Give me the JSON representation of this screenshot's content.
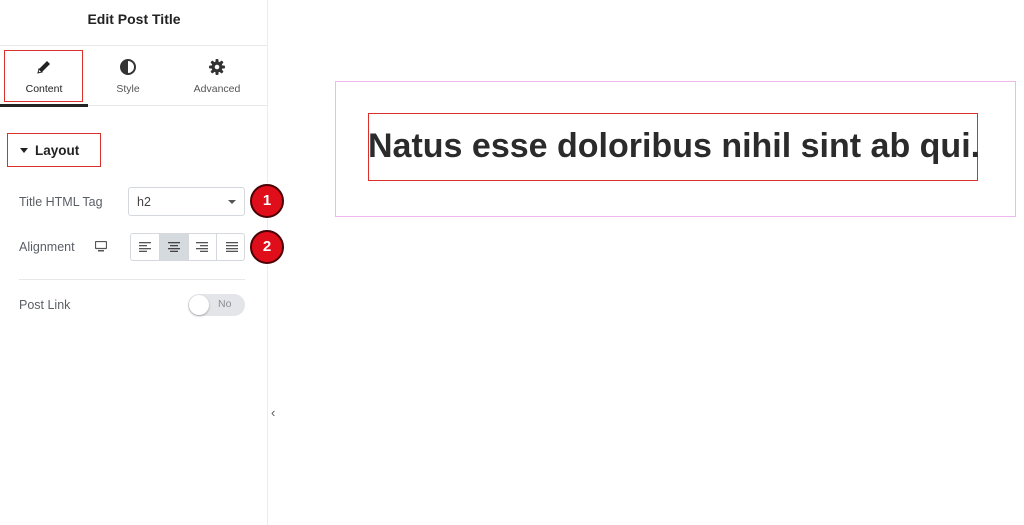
{
  "panel": {
    "title": "Edit Post Title",
    "tabs": [
      {
        "label": "Content",
        "icon": "pencil-icon",
        "active": true
      },
      {
        "label": "Style",
        "icon": "half-circle-icon",
        "active": false
      },
      {
        "label": "Advanced",
        "icon": "gear-icon",
        "active": false
      }
    ],
    "section": {
      "label": "Layout",
      "expanded": true
    },
    "controls": {
      "title_tag": {
        "label": "Title HTML Tag",
        "value": "h2",
        "badge": "1"
      },
      "alignment": {
        "label": "Alignment",
        "device_icon": "desktop-icon",
        "options": [
          "left",
          "center",
          "right",
          "justify"
        ],
        "selected": "center",
        "badge": "2"
      },
      "post_link": {
        "label": "Post Link",
        "state": "No"
      }
    }
  },
  "canvas": {
    "post_title": "Natus esse doloribus nihil sint ab qui."
  },
  "colors": {
    "highlight": "#d9302a",
    "badge": "#e00d1b",
    "widget_outline": "#f0b8f0"
  }
}
